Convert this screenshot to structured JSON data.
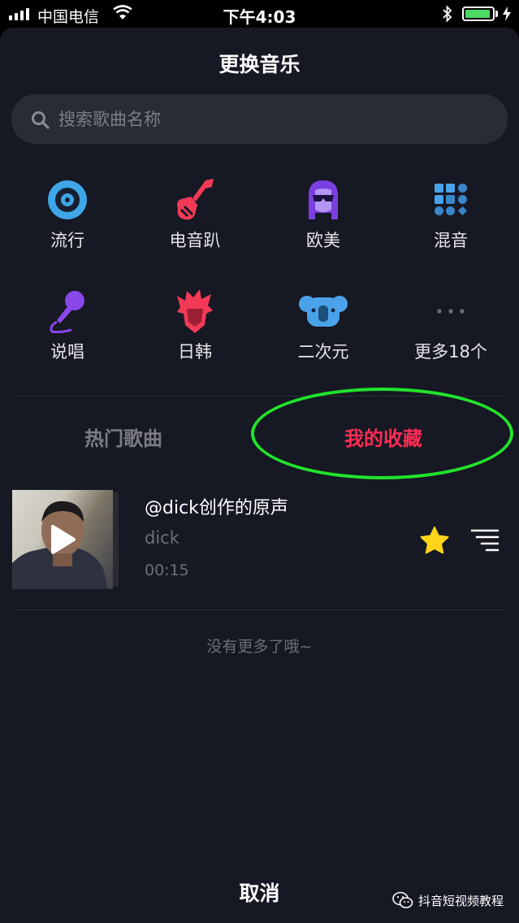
{
  "status_bar": {
    "carrier": "中国电信",
    "time": "下午4:03",
    "battery_level": 0.95,
    "battery_color": "#4cd964"
  },
  "sheet": {
    "title": "更换音乐",
    "search": {
      "placeholder": "搜索歌曲名称",
      "value": ""
    },
    "categories": [
      {
        "label": "流行",
        "icon": "disc-icon"
      },
      {
        "label": "电音趴",
        "icon": "electric-guitar-icon"
      },
      {
        "label": "欧美",
        "icon": "sunglasses-person-icon"
      },
      {
        "label": "混音",
        "icon": "dot-grid-icon"
      },
      {
        "label": "说唱",
        "icon": "microphone-icon"
      },
      {
        "label": "日韩",
        "icon": "anime-hair-icon"
      },
      {
        "label": "二次元",
        "icon": "koala-icon"
      },
      {
        "label": "更多18个",
        "icon": "more-dots-icon"
      }
    ],
    "tabs": [
      {
        "label": "热门歌曲",
        "active": false
      },
      {
        "label": "我的收藏",
        "active": true
      }
    ],
    "songs": [
      {
        "title": "@dick创作的原声",
        "author": "dick",
        "duration": "00:15",
        "favorited": true
      }
    ],
    "no_more": "没有更多了哦~",
    "cancel": "取消"
  },
  "watermark": {
    "text": "抖音短视频教程"
  },
  "colors": {
    "background": "#161823",
    "accent": "#fe2c55",
    "highlight_ellipse": "#21e32b",
    "star": "#fdd419"
  }
}
